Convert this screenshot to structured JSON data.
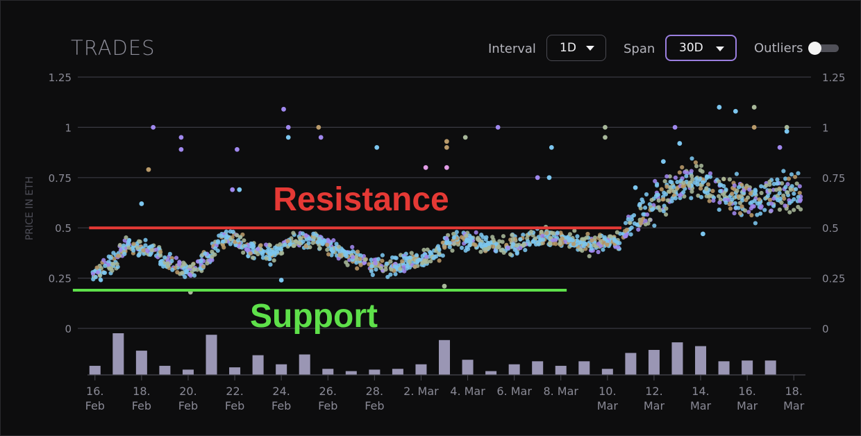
{
  "header": {
    "title": "TRADES",
    "interval_label": "Interval",
    "interval_value": "1D",
    "span_label": "Span",
    "span_value": "30D",
    "outliers_label": "Outliers",
    "outliers_on": false
  },
  "colors": {
    "background": "#0d0d0e",
    "grid": "#3a3a42",
    "axis_text": "#8a8a96",
    "volume_bar": "#9a96b4",
    "resistance": "#e53935",
    "support": "#5ee04a",
    "accent": "#9b7fe0",
    "point_blue": "#7cc6ef",
    "point_sage": "#a8b89a",
    "point_purple": "#a088ee",
    "point_tan": "#b99a6a",
    "point_pink": "#e19ce6"
  },
  "chart_data": {
    "type": "scatter",
    "ylabel": "PRICE IN ETH",
    "ylim": [
      0,
      1.25
    ],
    "yticks": [
      "1.25",
      "1",
      "0.75",
      "0.5",
      "0.25",
      "0"
    ],
    "ytick_values": [
      1.25,
      1,
      0.75,
      0.5,
      0.25,
      0
    ],
    "x_range": [
      0,
      31
    ],
    "x_ticks": [
      {
        "day": 0.5,
        "line1": "16.",
        "line2": "Feb"
      },
      {
        "day": 2.5,
        "line1": "18.",
        "line2": "Feb"
      },
      {
        "day": 4.5,
        "line1": "20.",
        "line2": "Feb"
      },
      {
        "day": 6.5,
        "line1": "22.",
        "line2": "Feb"
      },
      {
        "day": 8.5,
        "line1": "24.",
        "line2": "Feb"
      },
      {
        "day": 10.5,
        "line1": "26.",
        "line2": "Feb"
      },
      {
        "day": 12.5,
        "line1": "28.",
        "line2": "Feb"
      },
      {
        "day": 14.5,
        "line1": "2. Mar",
        "line2": ""
      },
      {
        "day": 16.5,
        "line1": "4. Mar",
        "line2": ""
      },
      {
        "day": 18.5,
        "line1": "6. Mar",
        "line2": ""
      },
      {
        "day": 20.5,
        "line1": "8. Mar",
        "line2": ""
      },
      {
        "day": 22.5,
        "line1": "10.",
        "line2": "Mar"
      },
      {
        "day": 24.5,
        "line1": "12.",
        "line2": "Mar"
      },
      {
        "day": 26.5,
        "line1": "14.",
        "line2": "Mar"
      },
      {
        "day": 28.5,
        "line1": "16.",
        "line2": "Mar"
      },
      {
        "day": 30.5,
        "line1": "18.",
        "line2": "Mar"
      }
    ],
    "trend_center": [
      [
        0,
        0.25
      ],
      [
        1,
        0.3
      ],
      [
        2,
        0.42
      ],
      [
        3,
        0.38
      ],
      [
        4,
        0.3
      ],
      [
        5,
        0.31
      ],
      [
        6,
        0.45
      ],
      [
        7,
        0.41
      ],
      [
        8,
        0.36
      ],
      [
        9,
        0.44
      ],
      [
        10,
        0.45
      ],
      [
        11,
        0.38
      ],
      [
        12,
        0.33
      ],
      [
        13,
        0.3
      ],
      [
        14,
        0.33
      ],
      [
        15,
        0.37
      ],
      [
        16,
        0.45
      ],
      [
        17,
        0.42
      ],
      [
        18,
        0.4
      ],
      [
        19,
        0.44
      ],
      [
        20,
        0.45
      ],
      [
        21,
        0.43
      ],
      [
        22,
        0.42
      ],
      [
        23,
        0.44
      ],
      [
        24,
        0.58
      ],
      [
        25,
        0.65
      ],
      [
        26,
        0.75
      ],
      [
        27,
        0.72
      ],
      [
        28,
        0.65
      ],
      [
        29,
        0.64
      ],
      [
        30,
        0.68
      ],
      [
        31,
        0.68
      ]
    ],
    "scatter_outliers": [
      [
        3.0,
        1.0,
        "purple"
      ],
      [
        2.8,
        0.79,
        "tan"
      ],
      [
        4.2,
        0.95,
        "purple"
      ],
      [
        4.2,
        0.89,
        "purple"
      ],
      [
        2.5,
        0.62,
        "blue"
      ],
      [
        6.6,
        0.89,
        "purple"
      ],
      [
        6.4,
        0.69,
        "purple"
      ],
      [
        6.7,
        0.69,
        "blue"
      ],
      [
        8.6,
        1.09,
        "purple"
      ],
      [
        8.8,
        1.0,
        "purple"
      ],
      [
        8.8,
        0.95,
        "blue"
      ],
      [
        10.1,
        1.0,
        "tan"
      ],
      [
        10.2,
        0.95,
        "purple"
      ],
      [
        12.6,
        0.9,
        "blue"
      ],
      [
        14.7,
        0.8,
        "pink"
      ],
      [
        15.6,
        0.8,
        "pink"
      ],
      [
        15.6,
        0.9,
        "tan"
      ],
      [
        15.6,
        0.93,
        "tan"
      ],
      [
        16.4,
        0.95,
        "sage"
      ],
      [
        17.8,
        1.0,
        "purple"
      ],
      [
        19.5,
        0.75,
        "purple"
      ],
      [
        20.1,
        0.9,
        "blue"
      ],
      [
        20.0,
        0.75,
        "blue"
      ],
      [
        22.4,
        1.0,
        "sage"
      ],
      [
        22.4,
        0.95,
        "sage"
      ],
      [
        23.7,
        0.7,
        "blue"
      ],
      [
        25.4,
        1.0,
        "purple"
      ],
      [
        25.6,
        0.92,
        "blue"
      ],
      [
        27.3,
        1.1,
        "blue"
      ],
      [
        28.0,
        1.08,
        "blue"
      ],
      [
        28.8,
        1.1,
        "sage"
      ],
      [
        28.8,
        1.0,
        "tan"
      ],
      [
        29.9,
        0.9,
        "purple"
      ],
      [
        30.2,
        1.0,
        "sage"
      ],
      [
        30.2,
        0.98,
        "blue"
      ],
      [
        4.6,
        0.18,
        "sage"
      ],
      [
        15.5,
        0.21,
        "sage"
      ],
      [
        8.5,
        0.24,
        "blue"
      ],
      [
        26.6,
        0.47,
        "blue"
      ],
      [
        24.9,
        0.83,
        "blue"
      ]
    ],
    "volume": [
      0.12,
      0.55,
      0.32,
      0.12,
      0.07,
      0.53,
      0.1,
      0.26,
      0.14,
      0.27,
      0.08,
      0.05,
      0.07,
      0.08,
      0.14,
      0.46,
      0.2,
      0.05,
      0.14,
      0.18,
      0.12,
      0.18,
      0.08,
      0.29,
      0.33,
      0.43,
      0.38,
      0.18,
      0.19,
      0.19
    ],
    "volume_max": 1.0,
    "annotations": [
      {
        "label": "Resistance",
        "y": 0.5,
        "x_start": 0.25,
        "x_end": 23.1,
        "color": "red"
      },
      {
        "label": "Support",
        "y": 0.19,
        "x_start": -0.45,
        "x_end": 20.75,
        "color": "green"
      }
    ]
  }
}
